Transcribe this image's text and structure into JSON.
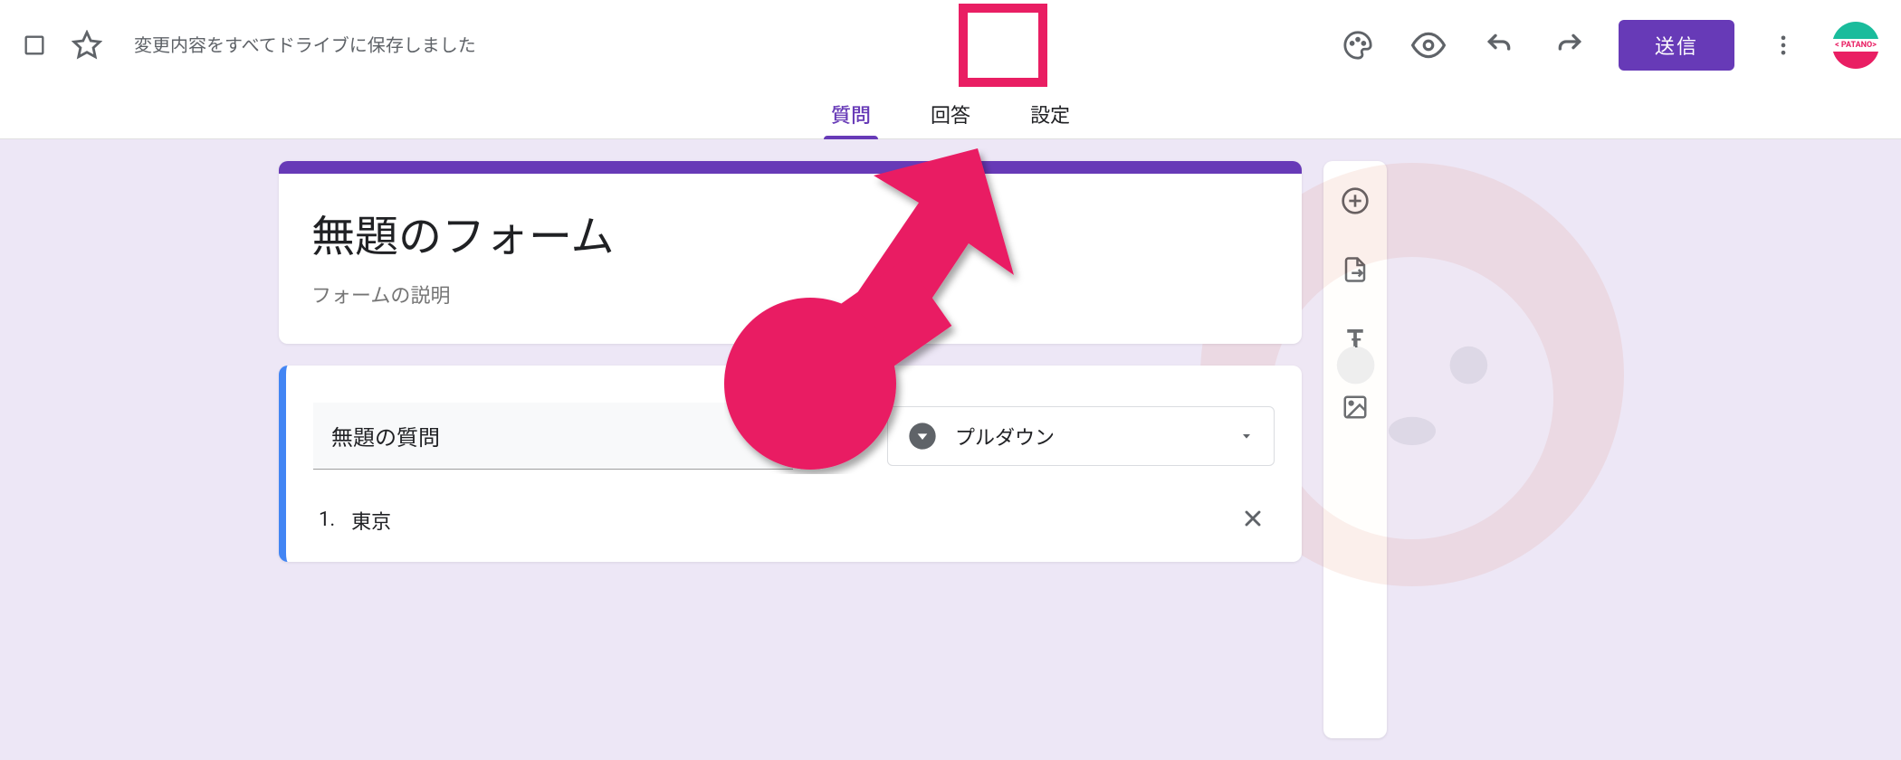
{
  "header": {
    "save_status": "変更内容をすべてドライブに保存しました",
    "send_label": "送信",
    "avatar_label": "< PATANO>"
  },
  "tabs": {
    "questions": "質問",
    "responses": "回答",
    "settings": "設定"
  },
  "form": {
    "title": "無題のフォーム",
    "description_placeholder": "フォームの説明"
  },
  "question": {
    "title": "無題の質問",
    "type_label": "プルダウン",
    "options": [
      {
        "index": "1.",
        "text": "東京"
      }
    ]
  },
  "icons": {
    "star": "star-icon",
    "palette": "palette-icon",
    "preview": "eye-icon",
    "undo": "undo-icon",
    "redo": "redo-icon",
    "more": "more-vert-icon",
    "image": "image-icon",
    "dropdown_circle": "dropdown-circle-icon",
    "arrow_down": "arrow-down-icon",
    "close": "close-icon",
    "add_question": "add-circle-icon",
    "import": "import-file-icon",
    "add_title": "text-title-icon",
    "add_image": "add-image-icon"
  }
}
